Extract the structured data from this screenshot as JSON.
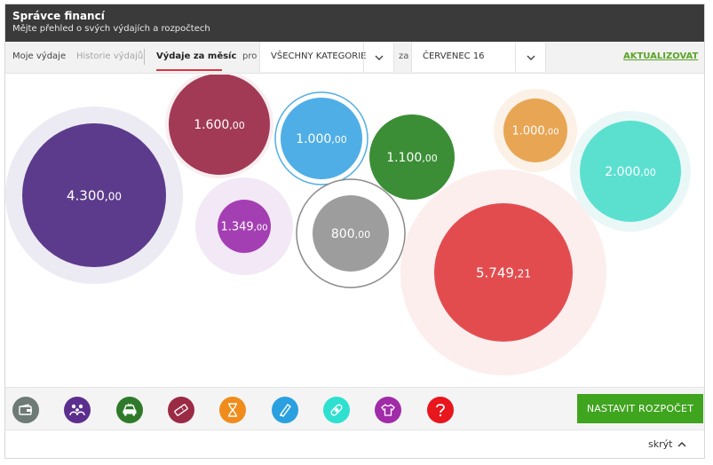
{
  "header": {
    "title": "Správce financí",
    "subtitle": "Mějte přehled o svých výdajích a rozpočtech"
  },
  "toolbar": {
    "tabs": [
      "Moje výdaje",
      "Historie výdajů",
      "Výdaje za měsíc"
    ],
    "active_tab": "Výdaje za měsíc",
    "pro_label": "pro",
    "category_select": "VŠECHNY KATEGORIE",
    "za_label": "za",
    "month_select": "ČERVENEC 16",
    "update_link": "AKTUALIZOVAT"
  },
  "bubbles": [
    {
      "name": "domacnost",
      "main": "4.300",
      "cents": ",00",
      "color": "#5c3b8c",
      "halo": "#ecebf4"
    },
    {
      "name": "zabava",
      "main": "1.600",
      "cents": ",00",
      "color": "#a23a55",
      "halo": "#f8eef1"
    },
    {
      "name": "obleceni",
      "main": "1.349",
      "cents": ",00",
      "color": "#a43fb3",
      "halo": "#f3e8f6"
    },
    {
      "name": "vzdelani",
      "main": "1.000",
      "cents": ",00",
      "color": "#4faee6",
      "ring": "#4faee6"
    },
    {
      "name": "ostatni-sede",
      "main": "800",
      "cents": ",00",
      "color": "#9d9d9d",
      "ring": "#8a8a8a"
    },
    {
      "name": "auto",
      "main": "1.100",
      "cents": ",00",
      "color": "#3b8e36"
    },
    {
      "name": "jine",
      "main": "5.749",
      "cents": ",21",
      "color": "#e34c4f",
      "halo": "#fdeeee"
    },
    {
      "name": "volny-cas",
      "main": "1.000",
      "cents": ",00",
      "color": "#e8a553",
      "halo": "#fcf1e6"
    },
    {
      "name": "zdravi",
      "main": "2.000",
      "cents": ",00",
      "color": "#5be0d0",
      "halo": "#e9f8f7"
    }
  ],
  "categories": [
    {
      "icon": "wallet-icon",
      "color": "#6d7a76"
    },
    {
      "icon": "family-icon",
      "color": "#5c2e8e"
    },
    {
      "icon": "car-icon",
      "color": "#2f7a2a"
    },
    {
      "icon": "ticket-icon",
      "color": "#9b2a45"
    },
    {
      "icon": "hourglass-icon",
      "color": "#f08c1c"
    },
    {
      "icon": "pen-icon",
      "color": "#2aa0e0"
    },
    {
      "icon": "bandage-icon",
      "color": "#2ee0cf"
    },
    {
      "icon": "shirt-icon",
      "color": "#a12ca8"
    },
    {
      "icon": "question-icon",
      "color": "#e8161d"
    }
  ],
  "budget_button": "NASTAVIT ROZPOČET",
  "footer": {
    "hide_label": "skrýt"
  }
}
